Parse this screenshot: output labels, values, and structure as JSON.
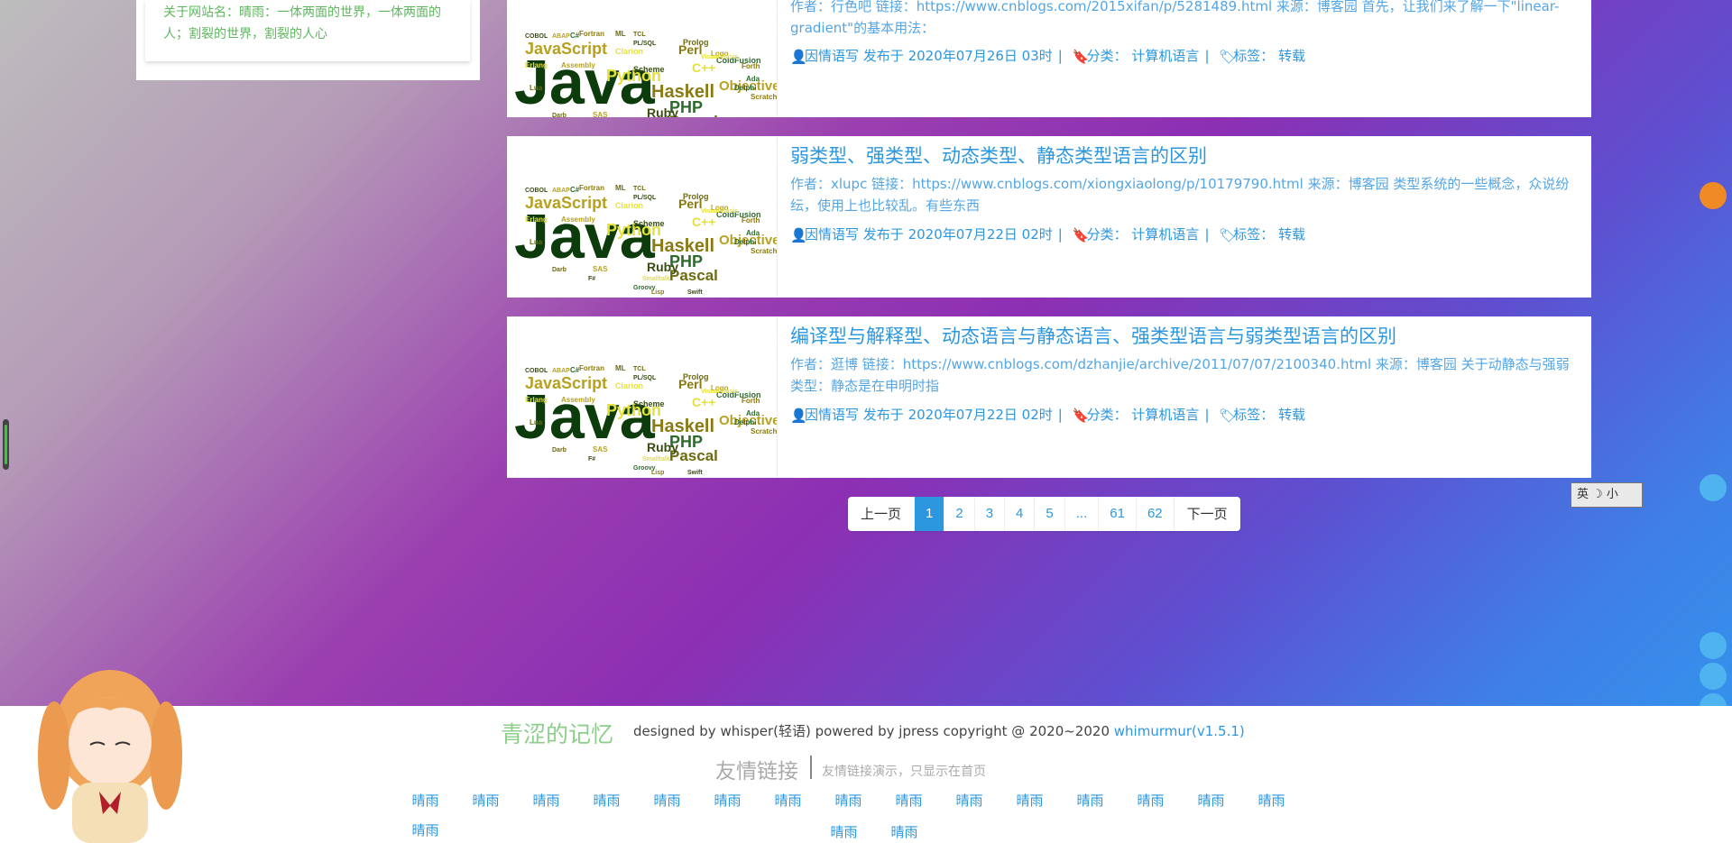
{
  "sidebar": {
    "about": "关于网站名：晴雨：一体两面的世界，一体两面的人；割裂的世界，割裂的人心"
  },
  "articles": [
    {
      "title": "",
      "summary": "作者：行色吧 链接：https://www.cnblogs.com/2015xifan/p/5281489.html 来源：博客园 首先，让我们来了解一下\"linear-gradient\"的基本用法：",
      "author": "因情语写",
      "posted": "发布于 2020年07月26日 03时",
      "category_label": "分类：",
      "category": "计算机语言",
      "tag_label": "标签：",
      "tag": "转载"
    },
    {
      "title": "弱类型、强类型、动态类型、静态类型语言的区别",
      "summary": "作者：xlupc 链接：https://www.cnblogs.com/xiongxiaolong/p/10179790.html 来源：博客园 类型系统的一些概念，众说纷纭，使用上也比较乱。有些东西",
      "author": "因情语写",
      "posted": "发布于 2020年07月22日 02时",
      "category_label": "分类：",
      "category": "计算机语言",
      "tag_label": "标签：",
      "tag": "转载"
    },
    {
      "title": "编译型与解释型、动态语言与静态语言、强类型语言与弱类型语言的区别",
      "summary": "作者：逛博 链接：https://www.cnblogs.com/dzhanjie/archive/2011/07/07/2100340.html 来源：博客园 关于动静态与强弱类型：静态是在申明时指",
      "author": "因情语写",
      "posted": "发布于 2020年07月22日 02时",
      "category_label": "分类：",
      "category": "计算机语言",
      "tag_label": "标签：",
      "tag": "转载"
    }
  ],
  "thumb_words": {
    "big": "Java",
    "words": [
      "Python",
      "JavaScript",
      "Haskell",
      "PHP",
      "Pascal",
      "Ruby",
      "C++",
      "Objective-C",
      "Perl",
      "ColdFusion",
      "Prolog",
      "Scheme",
      "Clarion",
      "Logo",
      "Forth",
      "Ada",
      "Lua",
      "COBOL",
      "Erlang",
      "Assembly",
      "Scratch",
      "Delphi",
      "TCL",
      "PL/SQL",
      "Visual Basic",
      "ABAP",
      "Fortran",
      "C#",
      "ML",
      "F#",
      "Smalltalk",
      "SAS",
      "Lisp",
      "Groovy",
      "Darb",
      "Swift"
    ]
  },
  "pagination": {
    "prev": "上一页",
    "pages": [
      "1",
      "2",
      "3",
      "4",
      "5",
      "...",
      "61",
      "62"
    ],
    "next": "下一页",
    "active": "1"
  },
  "footer": {
    "brand": "青涩的记忆",
    "copy": "designed by whisper(轻语) powered by jpress copyright @ 2020~2020",
    "version": "whimurmur(v1.5.1)",
    "links_title": "友情链接",
    "links_desc": "友情链接演示，只显示在首页",
    "friends_row1": [
      "晴雨",
      "晴雨",
      "晴雨",
      "晴雨",
      "晴雨",
      "晴雨",
      "晴雨",
      "晴雨",
      "晴雨",
      "晴雨",
      "晴雨",
      "晴雨",
      "晴雨",
      "晴雨",
      "晴雨",
      "晴雨"
    ],
    "friends_row2": [
      "晴雨",
      "晴雨"
    ]
  },
  "lang_widget": "英 ☽ 小",
  "colors": {
    "accent": "#2c97de",
    "green": "#5cb85c"
  }
}
